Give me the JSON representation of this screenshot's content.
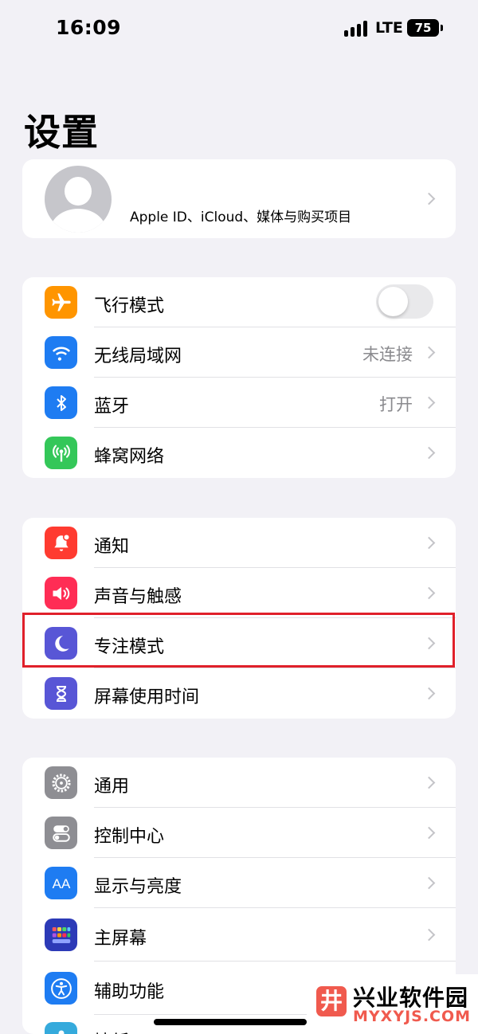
{
  "status_bar": {
    "time": "16:09",
    "network": "LTE",
    "battery": "75"
  },
  "page_title": "设置",
  "profile": {
    "subtitle": "Apple ID、iCloud、媒体与购买项目"
  },
  "groups": [
    {
      "rows": [
        {
          "label": "飞行模式",
          "icon": "airplane-icon",
          "color": "#ff9500"
        },
        {
          "label": "无线局域网",
          "value": "未连接",
          "icon": "wifi-icon",
          "color": "#1e7cf2"
        },
        {
          "label": "蓝牙",
          "value": "打开",
          "icon": "bluetooth-icon",
          "color": "#1e7cf2"
        },
        {
          "label": "蜂窝网络",
          "icon": "cellular-icon",
          "color": "#34c759"
        }
      ]
    },
    {
      "rows": [
        {
          "label": "通知",
          "icon": "notification-bell-icon",
          "color": "#ff3b30"
        },
        {
          "label": "声音与触感",
          "icon": "speaker-icon",
          "color": "#ff2d55"
        },
        {
          "label": "专注模式",
          "icon": "moon-icon",
          "color": "#5856d6"
        },
        {
          "label": "屏幕使用时间",
          "icon": "hourglass-icon",
          "color": "#5856d6"
        }
      ]
    },
    {
      "rows": [
        {
          "label": "通用",
          "icon": "gear-icon",
          "color": "#8e8e93"
        },
        {
          "label": "控制中心",
          "icon": "toggles-icon",
          "color": "#8e8e93"
        },
        {
          "label": "显示与亮度",
          "icon": "display-aa-icon",
          "color": "#1e7cf2"
        },
        {
          "label": "主屏幕",
          "icon": "home-screen-grid-icon",
          "color": "#2c3ab7"
        },
        {
          "label": "辅助功能",
          "icon": "accessibility-icon",
          "color": "#1e7cf2"
        },
        {
          "label": "墙纸",
          "icon": "wallpaper-icon",
          "color": "#35aadc"
        }
      ]
    }
  ],
  "watermark": {
    "title": "兴业软件园",
    "url": "MYXYJS.COM",
    "logo_glyph": "井"
  }
}
